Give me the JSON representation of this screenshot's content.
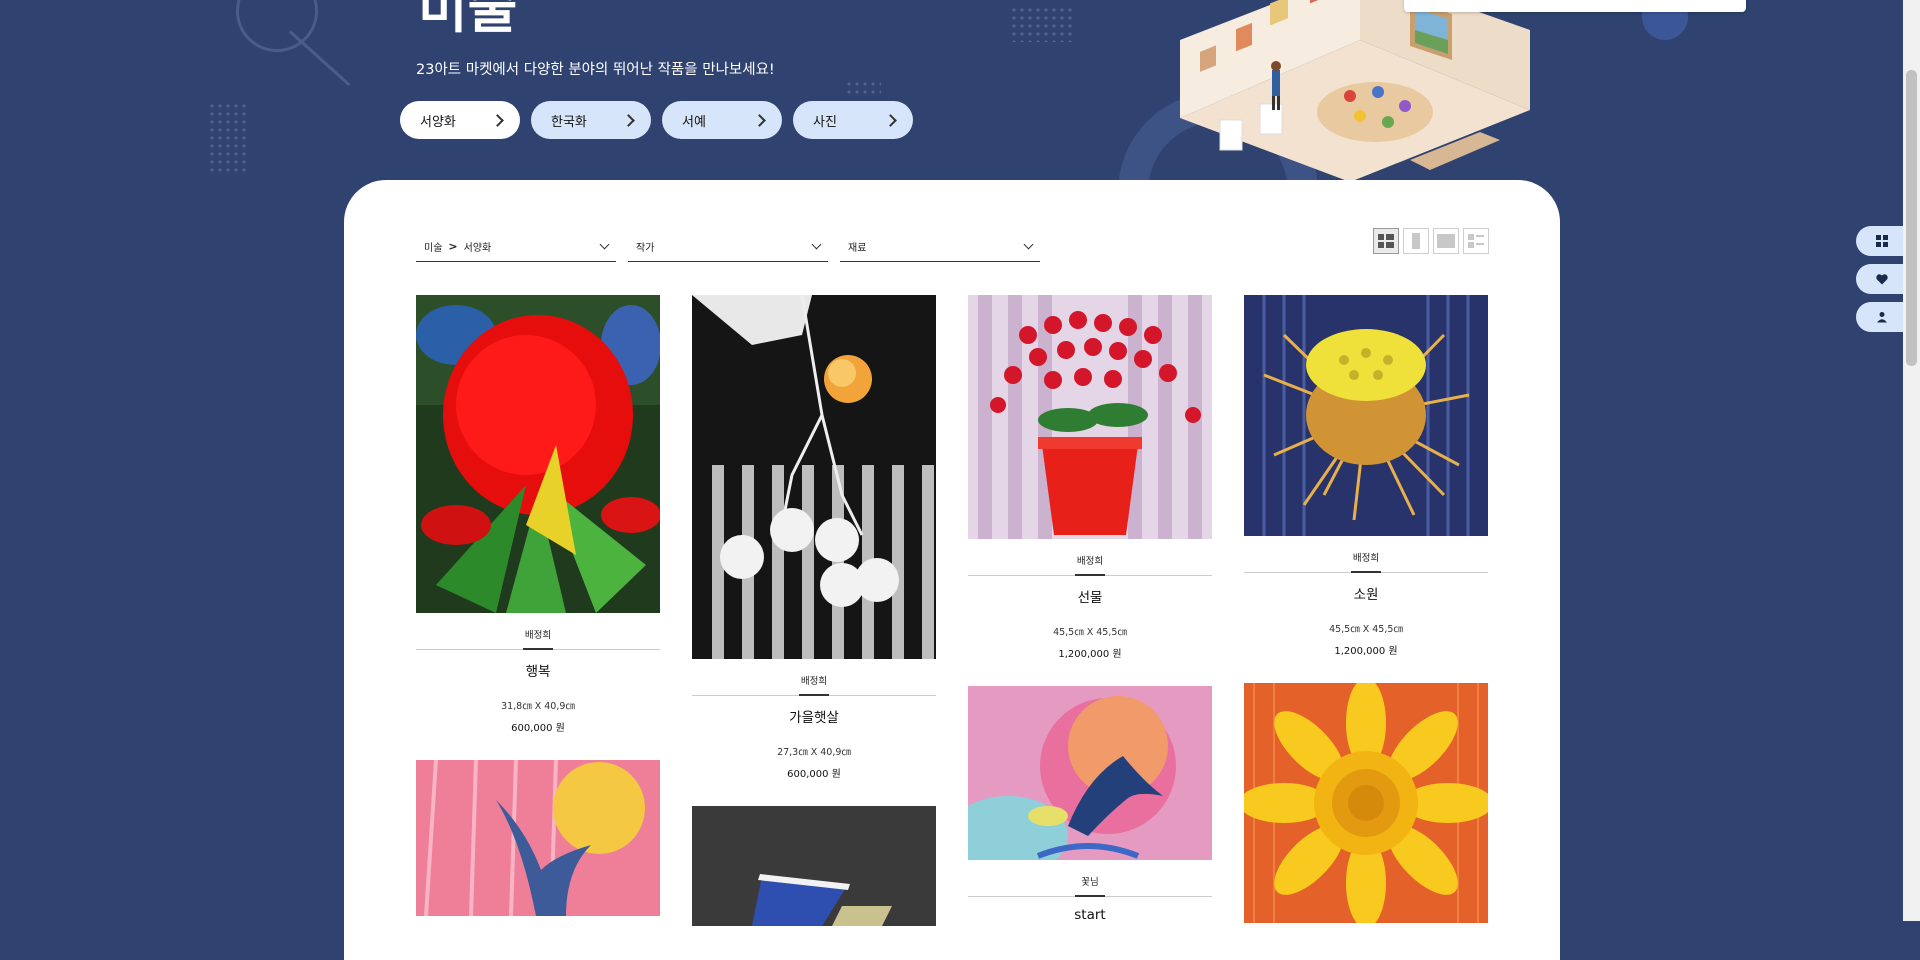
{
  "hero": {
    "title": "미술",
    "subtitle": "23아트 마켓에서 다양한 분야의 뛰어난 작품을 만나보세요!",
    "categories": [
      {
        "label": "서양화",
        "active": true
      },
      {
        "label": "한국화",
        "active": false
      },
      {
        "label": "서예",
        "active": false
      },
      {
        "label": "사진",
        "active": false
      }
    ]
  },
  "filters": {
    "breadcrumb_root": "미술",
    "breadcrumb_sep": ">",
    "breadcrumb_current": "서양화",
    "artist_label": "작가",
    "material_label": "재료"
  },
  "view_modes": [
    "grid-view-icon",
    "single-column-icon",
    "large-view-icon",
    "list-view-icon"
  ],
  "products": [
    {
      "artist": "배정희",
      "title": "행복",
      "size": "31,8㎝ X 40,9㎝",
      "price": "600,000 원"
    },
    {
      "artist": "배정희",
      "title": "가을햇살",
      "size": "27,3㎝ X 40,9㎝",
      "price": "600,000 원"
    },
    {
      "artist": "배정희",
      "title": "선물",
      "size": "45,5㎝ X 45,5㎝",
      "price": "1,200,000 원"
    },
    {
      "artist": "배정희",
      "title": "소원",
      "size": "45,5㎝ X 45,5㎝",
      "price": "1,200,000 원"
    },
    {
      "artist": "",
      "title": "",
      "size": "",
      "price": ""
    },
    {
      "artist": "",
      "title": "",
      "size": "",
      "price": ""
    },
    {
      "artist": "꽃님",
      "title": "start",
      "size": "",
      "price": ""
    },
    {
      "artist": "",
      "title": "",
      "size": "",
      "price": ""
    }
  ],
  "dock": [
    "grid-icon",
    "heart-icon",
    "user-icon"
  ],
  "colors": {
    "background": "#2f4270",
    "pill": "#d7e5fa",
    "card": "#ffffff"
  }
}
